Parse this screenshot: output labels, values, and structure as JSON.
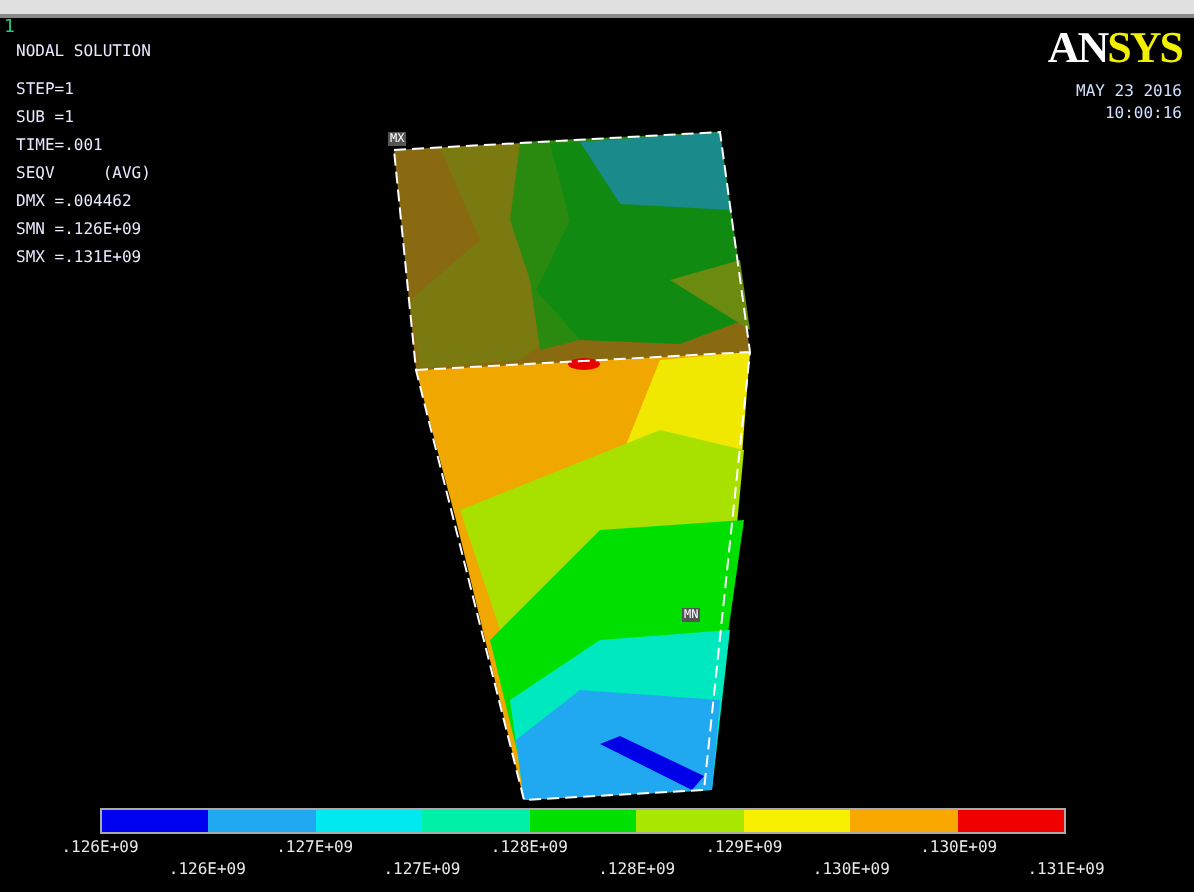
{
  "window_number": "1",
  "info_lines": [
    "NODAL SOLUTION",
    "STEP=1",
    "SUB =1",
    "TIME=.001",
    "SEQV     (AVG)",
    "DMX =.004462",
    "SMN =.126E+09",
    "SMX =.131E+09"
  ],
  "logo_parts": [
    "AN",
    "SYS"
  ],
  "date": "MAY 23 2016",
  "time": "10:00:16",
  "max_label": "MX",
  "min_label": "MN",
  "legend": {
    "bands": [
      {
        "color": "#0000f0"
      },
      {
        "color": "#20a8f0"
      },
      {
        "color": "#00e8f0"
      },
      {
        "color": "#00f0a8"
      },
      {
        "color": "#00e000"
      },
      {
        "color": "#a8e800"
      },
      {
        "color": "#f8f000"
      },
      {
        "color": "#f8a800"
      },
      {
        "color": "#f00000"
      }
    ],
    "labels": [
      ".126E+09",
      ".126E+09",
      ".127E+09",
      ".127E+09",
      ".128E+09",
      ".128E+09",
      ".129E+09",
      ".130E+09",
      ".130E+09",
      ".131E+09"
    ]
  }
}
